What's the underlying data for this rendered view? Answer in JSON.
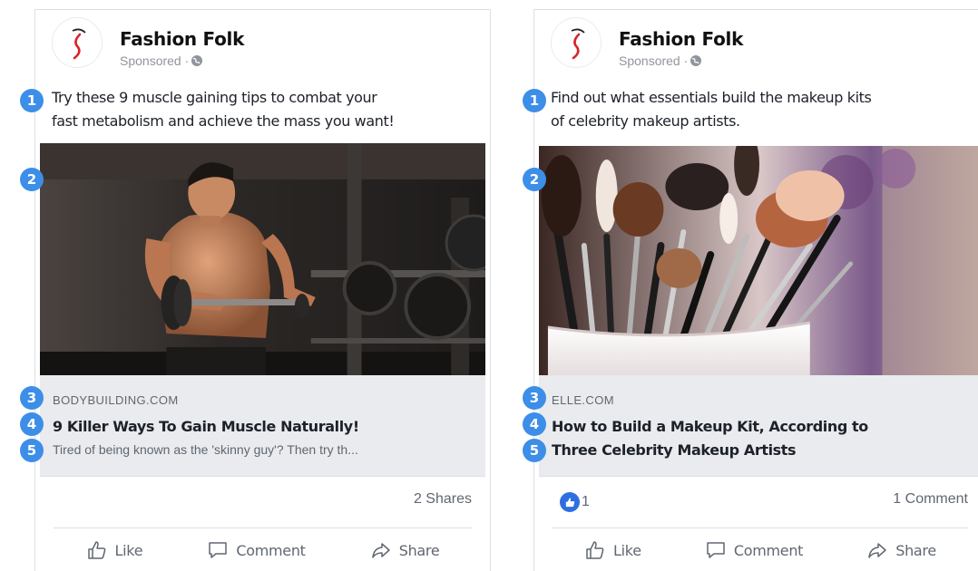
{
  "colors": {
    "marker": "#3d8ee8",
    "like_badge": "#2e6fe0",
    "link_box_bg": "#e9ebee",
    "secondary_text": "#606770",
    "logo_red": "#d7262a"
  },
  "markers": [
    "1",
    "2",
    "3",
    "4",
    "5"
  ],
  "actions": {
    "like": "Like",
    "comment": "Comment",
    "share": "Share"
  },
  "ads": [
    {
      "page_name": "Fashion Folk",
      "sponsored": "Sponsored · ",
      "text_line1": "Try these 9 muscle gaining tips to combat your",
      "text_line2": "fast metabolism and achieve the mass you want!",
      "image_icon": "bodybuilder-dumbbell-photo",
      "domain": "BODYBUILDING.COM",
      "title": "9 Killer Ways To Gain Muscle Naturally!",
      "description": "Tired of being known as the 'skinny guy'? Then try th...",
      "shares": "2 Shares"
    },
    {
      "page_name": "Fashion Folk",
      "sponsored": "Sponsored · ",
      "text_line1": "Find out what essentials build the makeup kits",
      "text_line2": "of celebrity makeup artists.",
      "image_icon": "makeup-brushes-photo",
      "domain": "ELLE.COM",
      "title_line1": "How to Build a Makeup Kit, According to",
      "title_line2": "Three Celebrity Makeup Artists",
      "likes": "1",
      "comments": "1 Comment"
    }
  ]
}
